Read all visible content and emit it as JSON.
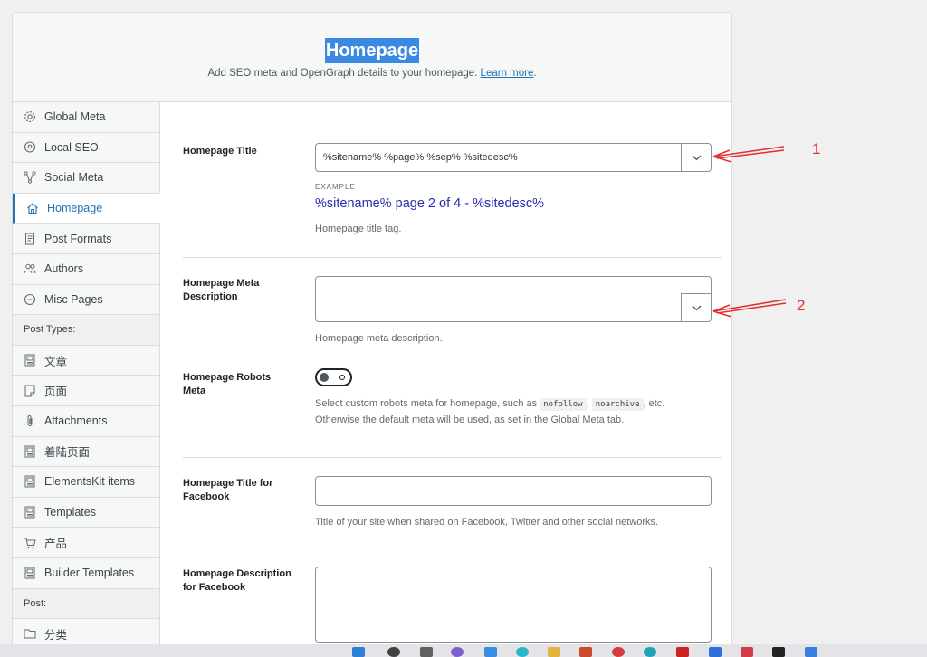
{
  "header": {
    "title": "Homepage",
    "subtitle": "Add SEO meta and OpenGraph details to your homepage.",
    "learn_more": "Learn more",
    "period": "."
  },
  "sidebar": {
    "items": [
      {
        "label": "Global Meta",
        "icon": "gear-icon"
      },
      {
        "label": "Local SEO",
        "icon": "location-icon"
      },
      {
        "label": "Social Meta",
        "icon": "share-icon"
      },
      {
        "label": "Homepage",
        "icon": "home-icon",
        "active": true
      },
      {
        "label": "Post Formats",
        "icon": "document-icon"
      },
      {
        "label": "Authors",
        "icon": "users-icon"
      },
      {
        "label": "Misc Pages",
        "icon": "no-icon"
      }
    ],
    "post_types_heading": "Post Types:",
    "post_types": [
      {
        "label": "文章",
        "icon": "post-icon"
      },
      {
        "label": "页面",
        "icon": "page-icon"
      },
      {
        "label": "Attachments",
        "icon": "paperclip-icon"
      },
      {
        "label": "着陆页面",
        "icon": "post-icon"
      },
      {
        "label": "ElementsKit items",
        "icon": "post-icon"
      },
      {
        "label": "Templates",
        "icon": "post-icon"
      },
      {
        "label": "产品",
        "icon": "cart-icon"
      },
      {
        "label": "Builder Templates",
        "icon": "post-icon"
      }
    ],
    "post_heading": "Post:",
    "post_items": [
      {
        "label": "分类",
        "icon": "folder-icon"
      }
    ]
  },
  "form": {
    "homepage_title": {
      "label": "Homepage Title",
      "value": "%sitename% %page% %sep% %sitedesc%",
      "example_label": "EXAMPLE",
      "example_value": "%sitename% page 2 of 4 - %sitedesc%",
      "help": "Homepage title tag."
    },
    "meta_description": {
      "label": "Homepage Meta Description",
      "value": "",
      "help": "Homepage meta description."
    },
    "robots_meta": {
      "label": "Homepage Robots Meta",
      "enabled": false,
      "help_before": "Select custom robots meta for homepage, such as",
      "code1": "nofollow",
      "comma": ",",
      "code2": "noarchive",
      "help_after": ", etc.",
      "help_line2": "Otherwise the default meta will be used, as set in the Global Meta tab."
    },
    "fb_title": {
      "label": "Homepage Title for Facebook",
      "value": "",
      "help": "Title of your site when shared on Facebook, Twitter and other social networks."
    },
    "fb_description": {
      "label": "Homepage Description for Facebook",
      "value": ""
    }
  },
  "annotations": {
    "one": "1",
    "two": "2",
    "color": "#e03030"
  },
  "colors": {
    "accent": "#2271b1",
    "title_highlight": "#3b89e0",
    "example_text": "#2b2bb0"
  }
}
